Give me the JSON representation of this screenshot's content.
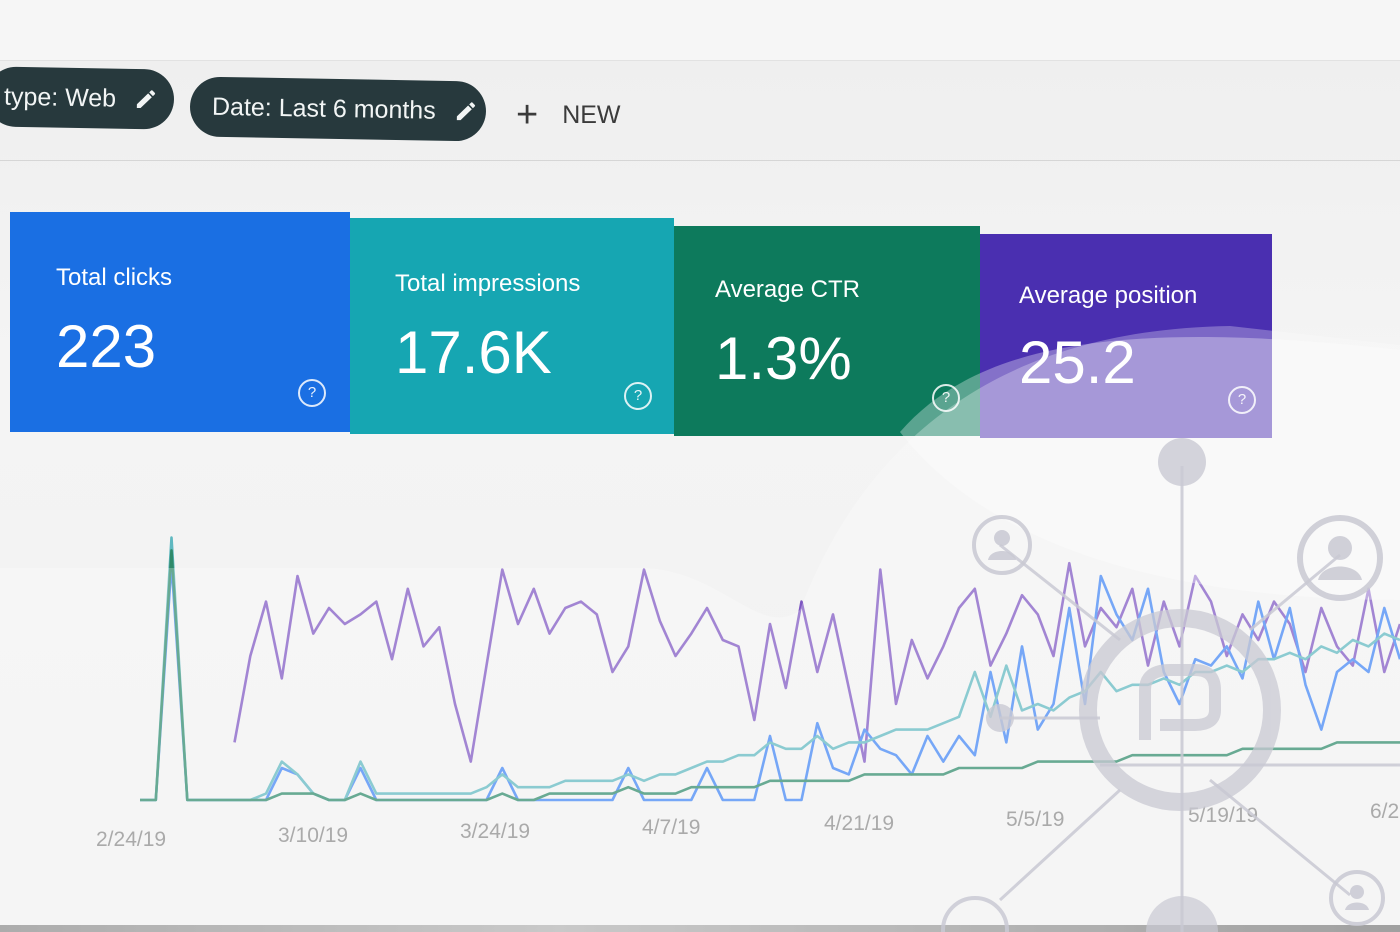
{
  "filters": {
    "type_chip": "type: Web",
    "date_chip": "Date: Last 6 months",
    "new_label": "NEW"
  },
  "cards": [
    {
      "label": "Total clicks",
      "value": "223",
      "color": "#1a73e8"
    },
    {
      "label": "Total impressions",
      "value": "17.6K",
      "color": "#12a4af"
    },
    {
      "label": "Average CTR",
      "value": "1.3%",
      "color": "#0f7f61"
    },
    {
      "label": "Average position",
      "value": "25.2",
      "color": "#5e35b1"
    }
  ],
  "help_glyph": "?",
  "colors": {
    "chip_bg": "#27393d",
    "clicks_line": "#4285f4",
    "impressions_line": "#5fb8c0",
    "ctr_line": "#2f8a6a",
    "position_line": "#7e57c2"
  },
  "chart_data": {
    "type": "line",
    "x_ticks": [
      "2/24/19",
      "3/10/19",
      "3/24/19",
      "4/7/19",
      "4/21/19",
      "5/5/19",
      "5/19/19",
      "6/2"
    ],
    "series": [
      {
        "key": "position",
        "color": "#7e57c2",
        "values": [
          null,
          null,
          null,
          null,
          null,
          null,
          18,
          45,
          62,
          38,
          70,
          52,
          60,
          55,
          58,
          62,
          44,
          66,
          48,
          54,
          30,
          12,
          42,
          72,
          55,
          66,
          52,
          60,
          62,
          58,
          40,
          48,
          72,
          56,
          45,
          52,
          60,
          50,
          48,
          25,
          55,
          35,
          62,
          40,
          58,
          35,
          12,
          72,
          30,
          50,
          38,
          48,
          60,
          66,
          42,
          52,
          64,
          58,
          45,
          74,
          48,
          60,
          54,
          66,
          42,
          62,
          48,
          70,
          62,
          45,
          58,
          50,
          62,
          55,
          40,
          60,
          48,
          42,
          66,
          40,
          55
        ]
      },
      {
        "key": "clicks",
        "color": "#4285f4",
        "values": [
          0,
          0,
          74,
          0,
          0,
          0,
          0,
          0,
          0,
          10,
          8,
          2,
          0,
          0,
          10,
          0,
          0,
          0,
          0,
          0,
          0,
          0,
          0,
          10,
          0,
          0,
          0,
          0,
          0,
          0,
          0,
          10,
          0,
          0,
          0,
          0,
          10,
          0,
          0,
          0,
          20,
          0,
          0,
          24,
          10,
          8,
          22,
          16,
          14,
          8,
          20,
          12,
          20,
          14,
          40,
          18,
          48,
          22,
          30,
          60,
          30,
          70,
          58,
          50,
          66,
          40,
          30,
          44,
          42,
          48,
          38,
          62,
          44,
          60,
          36,
          22,
          40,
          44,
          40,
          60,
          44
        ]
      },
      {
        "key": "impressions",
        "color": "#5fb8c0",
        "values": [
          0,
          0,
          82,
          0,
          0,
          0,
          0,
          0,
          2,
          12,
          8,
          2,
          0,
          0,
          12,
          2,
          2,
          2,
          2,
          2,
          2,
          2,
          4,
          8,
          4,
          4,
          4,
          6,
          6,
          6,
          6,
          8,
          6,
          8,
          8,
          10,
          12,
          12,
          14,
          14,
          18,
          16,
          16,
          20,
          16,
          18,
          18,
          20,
          22,
          22,
          22,
          24,
          26,
          40,
          26,
          42,
          28,
          30,
          28,
          32,
          34,
          40,
          34,
          36,
          36,
          38,
          36,
          40,
          40,
          42,
          40,
          44,
          44,
          46,
          44,
          48,
          46,
          50,
          48,
          52,
          50
        ]
      },
      {
        "key": "ctr",
        "color": "#2f8a6a",
        "values": [
          0,
          0,
          78,
          0,
          0,
          0,
          0,
          0,
          0,
          2,
          2,
          2,
          0,
          0,
          2,
          0,
          0,
          0,
          0,
          0,
          0,
          0,
          0,
          2,
          0,
          0,
          2,
          2,
          2,
          2,
          2,
          4,
          2,
          2,
          2,
          4,
          4,
          4,
          4,
          4,
          6,
          6,
          6,
          6,
          6,
          6,
          8,
          8,
          8,
          8,
          8,
          8,
          10,
          10,
          10,
          10,
          10,
          12,
          12,
          12,
          12,
          12,
          12,
          14,
          14,
          14,
          14,
          14,
          14,
          14,
          16,
          16,
          16,
          16,
          16,
          16,
          18,
          18,
          18,
          18,
          18
        ]
      }
    ]
  }
}
